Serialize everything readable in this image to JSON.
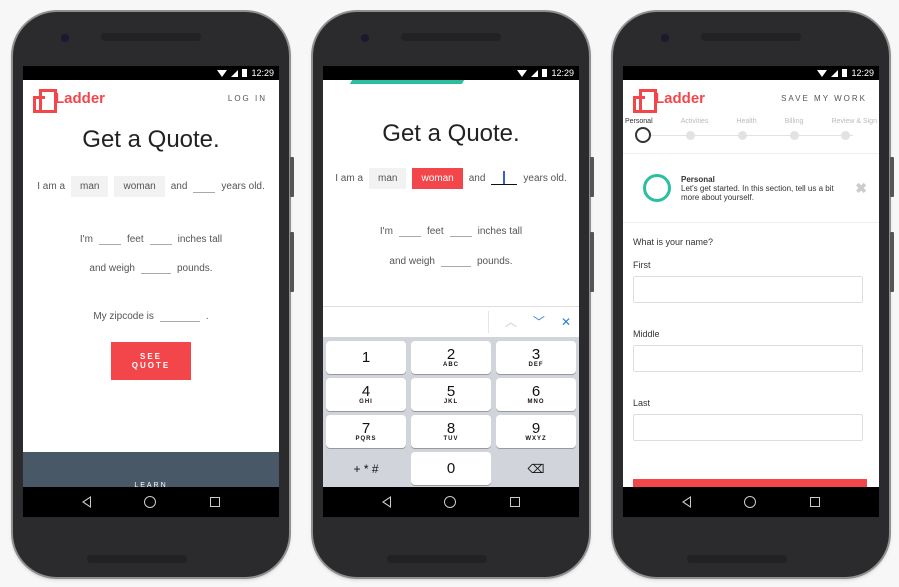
{
  "status_bar": {
    "time": "12:29"
  },
  "phone1": {
    "logo": "Ladder",
    "header_link": "LOG IN",
    "title": "Get a Quote.",
    "line1": {
      "prefix": "I am a",
      "option_man": "man",
      "option_woman": "woman",
      "middle": "and",
      "suffix": "years old."
    },
    "line2": {
      "prefix": "I'm",
      "feet": "feet",
      "inches": "inches tall"
    },
    "line3": {
      "prefix": "and weigh",
      "suffix": "pounds."
    },
    "line4": {
      "prefix": "My zipcode is",
      "suffix": "."
    },
    "cta": "SEE QUOTE",
    "footer": "LEARN"
  },
  "phone2": {
    "title": "Get a Quote.",
    "line1": {
      "prefix": "I am a",
      "option_man": "man",
      "option_woman": "woman",
      "selected": "woman",
      "middle": "and",
      "suffix": "years old."
    },
    "line2": {
      "prefix": "I'm",
      "feet": "feet",
      "inches": "inches tall"
    },
    "line3": {
      "prefix": "and weigh",
      "suffix": "pounds."
    },
    "keyboard": {
      "keys": [
        {
          "num": "1",
          "letters": ""
        },
        {
          "num": "2",
          "letters": "ABC"
        },
        {
          "num": "3",
          "letters": "DEF"
        },
        {
          "num": "4",
          "letters": "GHI"
        },
        {
          "num": "5",
          "letters": "JKL"
        },
        {
          "num": "6",
          "letters": "MNO"
        },
        {
          "num": "7",
          "letters": "PQRS"
        },
        {
          "num": "8",
          "letters": "TUV"
        },
        {
          "num": "9",
          "letters": "WXYZ"
        }
      ],
      "symbols": "+ * #",
      "zero": "0",
      "backspace": "⌫",
      "up": "︿",
      "down": "﹀",
      "close": "✕"
    }
  },
  "phone3": {
    "logo": "Ladder",
    "header_link": "SAVE MY WORK",
    "steps": [
      "Personal",
      "Activities",
      "Health",
      "Billing",
      "Review & Sign"
    ],
    "current_step": "Personal",
    "intro": {
      "title": "Personal",
      "body": "Let's get started. In this section, tell us a bit more about yourself.",
      "close": "✖"
    },
    "question": "What is your name?",
    "fields": [
      {
        "label": "First",
        "value": ""
      },
      {
        "label": "Middle",
        "value": ""
      },
      {
        "label": "Last",
        "value": ""
      }
    ]
  },
  "colors": {
    "brand_red": "#f2464b",
    "teal": "#2bbfa0",
    "footer_slate": "#485866",
    "link_blue": "#2d7fd6"
  }
}
